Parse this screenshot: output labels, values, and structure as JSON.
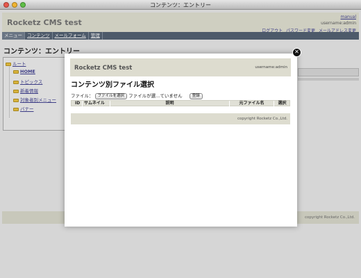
{
  "window": {
    "title": "コンテンツ：エントリー"
  },
  "header": {
    "site_title": "Rocketz CMS test",
    "manual_link": "manual",
    "user": "username:admin",
    "links": [
      "ログアウト",
      "パスワード変更",
      "メールアドレス変更"
    ]
  },
  "nav": {
    "items": [
      "メニュー",
      "コンテンツ",
      "メールフォーム",
      "管理"
    ]
  },
  "page": {
    "heading": "コンテンツ：エントリー"
  },
  "tree": {
    "root": "ルート",
    "items": [
      "HOME",
      "トピックス",
      "新着情報",
      "対象者別メニュー",
      "バナー"
    ]
  },
  "footer": {
    "copyright": "copyright Rocketz Co.,Ltd."
  },
  "modal": {
    "title": "Rocketz CMS test",
    "user": "username:admin",
    "heading": "コンテンツ別ファイル選択",
    "file_label": "ファイル：",
    "choose_button": "ファイルを選択",
    "no_file_text": "ファイルが選...ていません",
    "register_button": "登録",
    "table_headers": [
      "ID",
      "サムネイル",
      "説明",
      "元ファイル名",
      "選択"
    ],
    "footer": "copyright Rocketz Co.,Ltd."
  },
  "icons": {
    "close": "close-icon",
    "folder": "folder-icon"
  },
  "colors": {
    "nav_bg": "#4d5a6a",
    "header_bg": "#dddccf",
    "link": "#3d3d86"
  }
}
